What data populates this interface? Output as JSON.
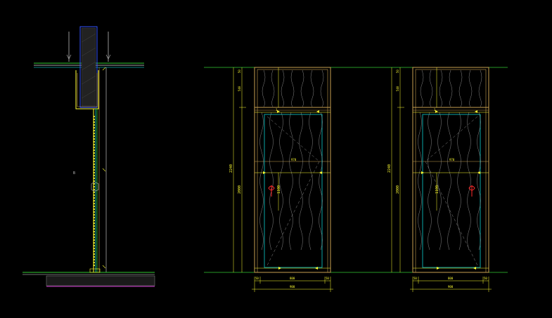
{
  "drawing": {
    "colors": {
      "background": "#000000",
      "dimension": "#ffff33",
      "frame": "#c8a050",
      "panel": "#0aa6a6",
      "ground": "#33cc33",
      "handle": "#ff2a2a",
      "wall": "#3355ff",
      "white": "#dddddd",
      "magenta": "#cc33cc"
    },
    "section_label": "B",
    "door1": {
      "height_label": "2240",
      "inner_height_label": "2000",
      "top_dim_1": "50",
      "top_dim_2": "540",
      "header_label": "1",
      "mid_label": "970",
      "panel_label": "1100",
      "bottom_dims": [
        "50",
        "800",
        "50"
      ],
      "overall_width": "900"
    },
    "door2": {
      "height_label": "2240",
      "inner_height_label": "2000",
      "top_dim_1": "50",
      "top_dim_2": "540",
      "header_label": "1",
      "mid_label": "970",
      "panel_label": "1100",
      "bottom_dims": [
        "50",
        "800",
        "50"
      ],
      "overall_width": "900"
    }
  }
}
